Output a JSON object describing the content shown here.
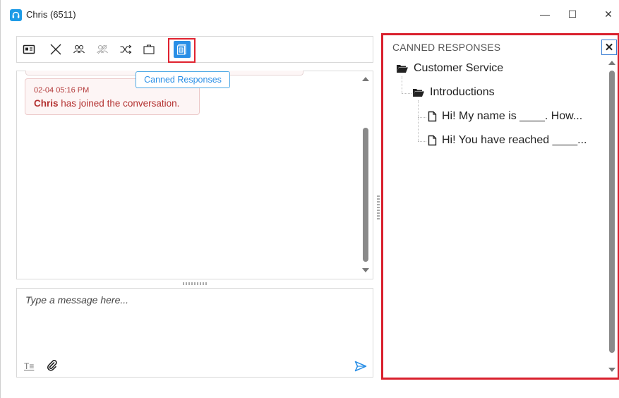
{
  "window": {
    "title": "Chris (6511)",
    "minimize_glyph": "—",
    "maximize_glyph": "☐",
    "close_glyph": "✕"
  },
  "toolbar": {
    "items": [
      {
        "icon": "contact-card-icon",
        "enabled": true
      },
      {
        "icon": "close-conversation-icon",
        "enabled": true
      },
      {
        "icon": "add-participant-icon",
        "enabled": true
      },
      {
        "icon": "remove-participant-icon",
        "enabled": false
      },
      {
        "icon": "transfer-icon",
        "enabled": true
      },
      {
        "icon": "briefcase-icon",
        "enabled": true
      },
      {
        "icon": "canned-responses-icon",
        "enabled": true,
        "active": true
      }
    ],
    "tooltip": "Canned Responses"
  },
  "chat": {
    "messages": [
      {
        "time": "02-04 05:16 PM",
        "name": "Chris",
        "text": " has joined the conversation."
      }
    ]
  },
  "compose": {
    "placeholder": "Type a message here...",
    "format_glyph": "T≡"
  },
  "canned_panel": {
    "title": "CANNED RESPONSES",
    "close_glyph": "✕",
    "tree": {
      "folder": "Customer Service",
      "subfolder": "Introductions",
      "responses": [
        "Hi! My name is ____. How...",
        "Hi! You have reached ____..."
      ]
    }
  },
  "colors": {
    "accent": "#2a8fe6",
    "highlight_border": "#d9202d",
    "system_text": "#b3302f"
  }
}
